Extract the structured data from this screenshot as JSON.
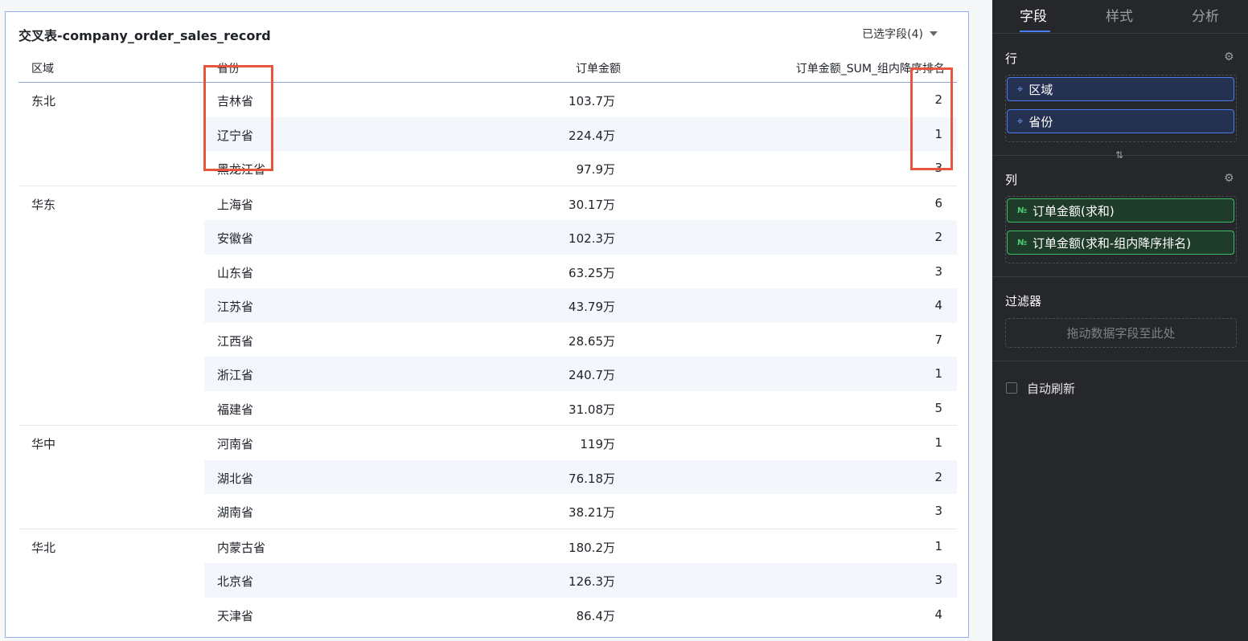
{
  "card": {
    "title": "交叉表-company_order_sales_record",
    "selected_fields": "已选字段(4)"
  },
  "table": {
    "headers": {
      "region": "区域",
      "province": "省份",
      "amount": "订单金额",
      "rank": "订单金额_SUM_组内降序排名"
    },
    "groups": [
      {
        "name": "东北",
        "rows": [
          {
            "province": "吉林省",
            "amount": "103.7万",
            "rank": "2"
          },
          {
            "province": "辽宁省",
            "amount": "224.4万",
            "rank": "1"
          },
          {
            "province": "黑龙江省",
            "amount": "97.9万",
            "rank": "3"
          }
        ]
      },
      {
        "name": "华东",
        "rows": [
          {
            "province": "上海省",
            "amount": "30.17万",
            "rank": "6"
          },
          {
            "province": "安徽省",
            "amount": "102.3万",
            "rank": "2"
          },
          {
            "province": "山东省",
            "amount": "63.25万",
            "rank": "3"
          },
          {
            "province": "江苏省",
            "amount": "43.79万",
            "rank": "4"
          },
          {
            "province": "江西省",
            "amount": "28.65万",
            "rank": "7"
          },
          {
            "province": "浙江省",
            "amount": "240.7万",
            "rank": "1"
          },
          {
            "province": "福建省",
            "amount": "31.08万",
            "rank": "5"
          }
        ]
      },
      {
        "name": "华中",
        "rows": [
          {
            "province": "河南省",
            "amount": "119万",
            "rank": "1"
          },
          {
            "province": "湖北省",
            "amount": "76.18万",
            "rank": "2"
          },
          {
            "province": "湖南省",
            "amount": "38.21万",
            "rank": "3"
          }
        ]
      },
      {
        "name": "华北",
        "rows": [
          {
            "province": "内蒙古省",
            "amount": "180.2万",
            "rank": "1"
          },
          {
            "province": "北京省",
            "amount": "126.3万",
            "rank": "3"
          },
          {
            "province": "天津省",
            "amount": "86.4万",
            "rank": "4"
          }
        ]
      }
    ]
  },
  "sidebar": {
    "tabs": [
      "字段",
      "样式",
      "分析"
    ],
    "active_tab": "字段",
    "rows_section": {
      "title": "行",
      "fields": [
        "区域",
        "省份"
      ]
    },
    "cols_section": {
      "title": "列",
      "fields": [
        "订单金额(求和)",
        "订单金额(求和-组内降序排名)"
      ]
    },
    "filter_section": {
      "title": "过滤器",
      "placeholder": "拖动数据字段至此处"
    },
    "auto_refresh": {
      "label": "自动刷新",
      "checked": false
    },
    "icons": {
      "dimension": "location-pin-icon",
      "measure": "number-icon",
      "gear": "gear-icon",
      "swap": "swap-icon"
    },
    "colors": {
      "background": "#25272b",
      "accent": "#4f7df9",
      "dimension_border": "#4d7bf3",
      "measure_border": "#3fbb63",
      "highlight": "#e8553c"
    }
  }
}
